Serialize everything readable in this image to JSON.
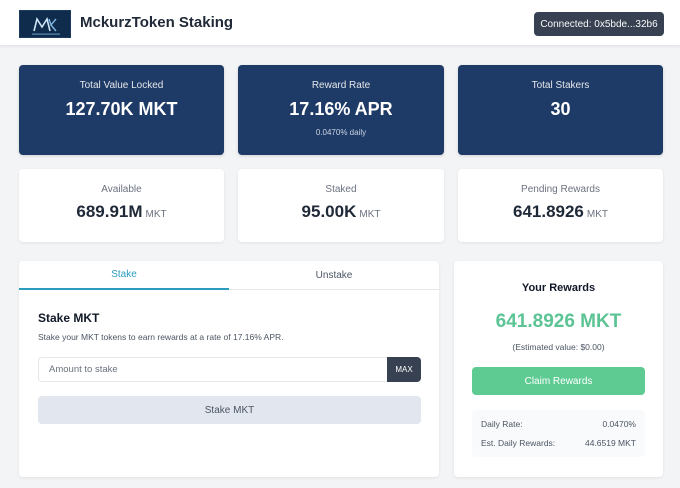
{
  "header": {
    "title": "MckurzToken Staking",
    "wallet_label": "Connected: 0x5bde...32b6"
  },
  "stats_top": [
    {
      "label": "Total Value Locked",
      "value": "127.70K MKT"
    },
    {
      "label": "Reward Rate",
      "value": "17.16% APR",
      "sub": "0.0470% daily"
    },
    {
      "label": "Total Stakers",
      "value": "30"
    }
  ],
  "stats_balance": [
    {
      "label": "Available",
      "value": "689.91M",
      "unit": "MKT"
    },
    {
      "label": "Staked",
      "value": "95.00K",
      "unit": "MKT"
    },
    {
      "label": "Pending Rewards",
      "value": "641.8926",
      "unit": "MKT"
    }
  ],
  "stake_panel": {
    "tabs": [
      {
        "label": "Stake",
        "active": true
      },
      {
        "label": "Unstake",
        "active": false
      }
    ],
    "title": "Stake MKT",
    "description": "Stake your MKT tokens to earn rewards at a rate of 17.16% APR.",
    "amount_placeholder": "Amount to stake",
    "max_label": "MAX",
    "submit_label": "Stake MKT"
  },
  "rewards_panel": {
    "title": "Your Rewards",
    "amount": "641.8926 MKT",
    "estimate": "(Estimated value: $0.00)",
    "claim_label": "Claim Rewards",
    "rows": [
      {
        "label": "Daily Rate:",
        "value": "0.0470%"
      },
      {
        "label": "Est. Daily Rewards:",
        "value": "44.6519 MKT"
      }
    ]
  },
  "colors": {
    "dark_card": "#1e3a66",
    "accent_tab": "#2a9dbf",
    "reward_green": "#5cc494",
    "claim_button": "#5ecb93",
    "button_dark": "#374151"
  }
}
